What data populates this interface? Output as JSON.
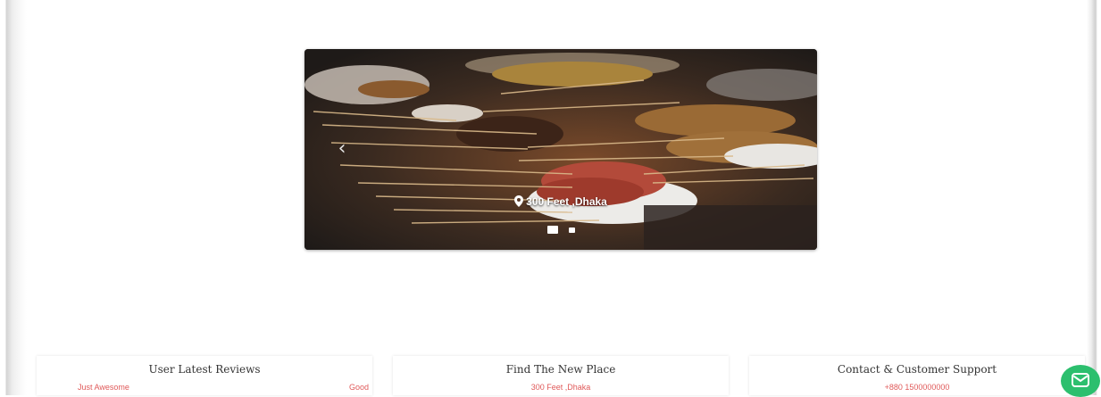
{
  "slider": {
    "location": "300 Feet ,Dhaka",
    "prev_icon": "chevron-left-icon",
    "pin_icon": "map-marker-icon",
    "slides": 2,
    "active_slide": 1
  },
  "cards": {
    "reviews": {
      "title": "User Latest Reviews",
      "left": "Just Awesome",
      "right": "Good"
    },
    "new_place": {
      "title": "Find The New Place",
      "place": "300 Feet ,Dhaka"
    },
    "support": {
      "title": "Contact & Customer Support",
      "phone": "+880 1500000000"
    }
  },
  "chat": {
    "icon": "envelope-icon",
    "color": "#2cbf6e"
  },
  "colors": {
    "accent_red": "#e05a5a"
  }
}
